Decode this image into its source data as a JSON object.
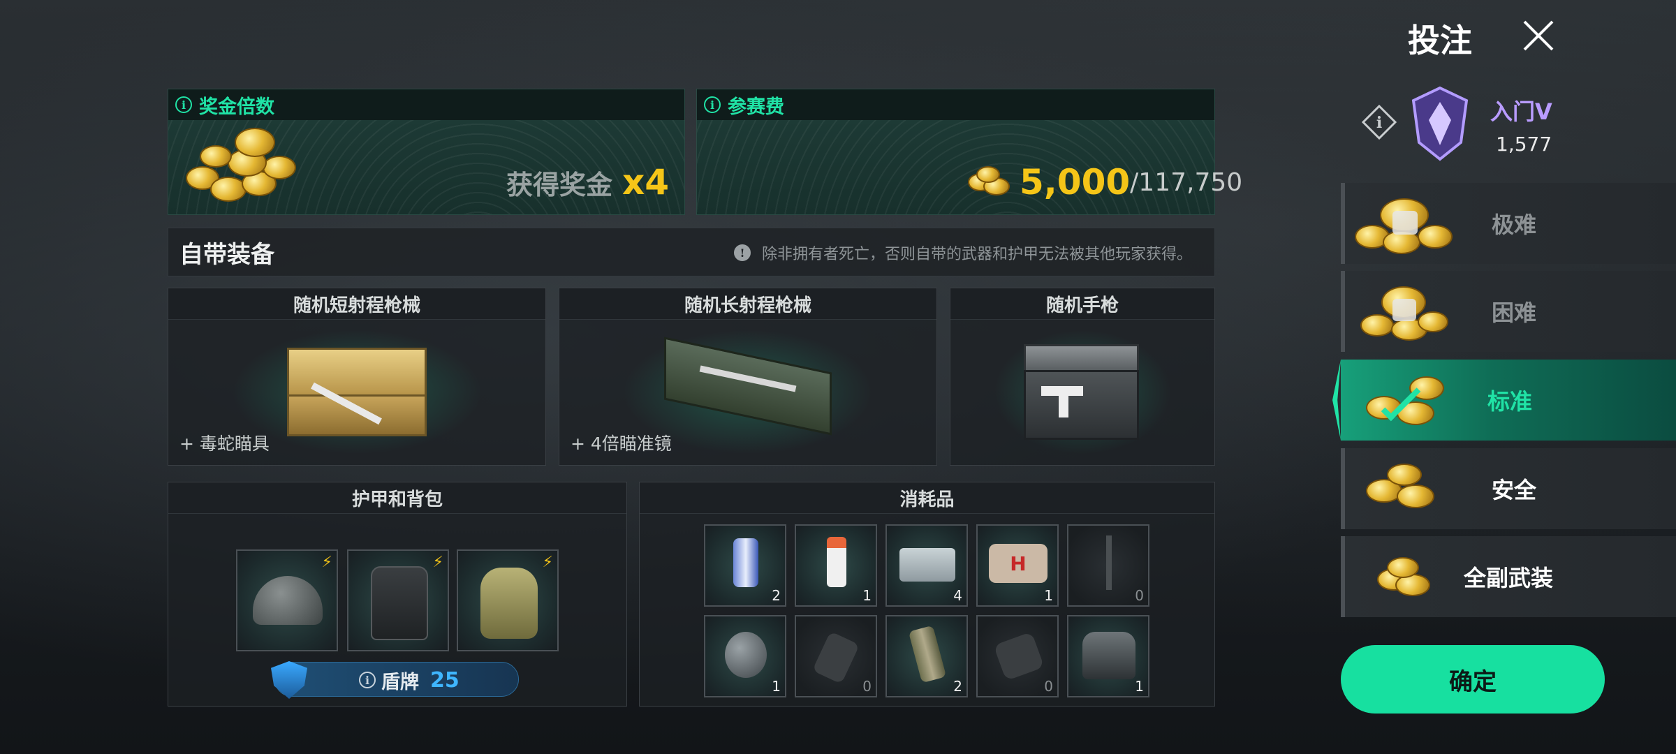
{
  "header": {
    "title": "投注"
  },
  "rank": {
    "name": "入门V",
    "points": "1,577"
  },
  "prize": {
    "header": "奖金倍数",
    "text": "获得奖金",
    "multiplier": "x4"
  },
  "fee": {
    "header": "参赛费",
    "amount": "5,000",
    "balance": "/117,750"
  },
  "equipment": {
    "title": "自带装备",
    "notice": "除非拥有者死亡，否则自带的武器和护甲无法被其他玩家获得。",
    "weapons": [
      {
        "title": "随机短射程枪械",
        "attachment": "+ 毒蛇瞄具"
      },
      {
        "title": "随机长射程枪械",
        "attachment": "+ 4倍瞄准镜"
      },
      {
        "title": "随机手枪",
        "attachment": ""
      }
    ]
  },
  "armor": {
    "title": "护甲和背包",
    "items": [
      {
        "icon": "helmet-icon"
      },
      {
        "icon": "vest-icon"
      },
      {
        "icon": "backpack-icon"
      }
    ],
    "shield_label": "盾牌",
    "shield_value": "25"
  },
  "consumables": {
    "title": "消耗品",
    "items": [
      {
        "icon": "energy-drink-icon",
        "count": "2"
      },
      {
        "icon": "painkiller-icon",
        "count": "1"
      },
      {
        "icon": "bandage-icon",
        "count": "4"
      },
      {
        "icon": "medkit-icon",
        "count": "1"
      },
      {
        "icon": "syringe-icon",
        "count": "0"
      },
      {
        "icon": "frag-grenade-icon",
        "count": "1"
      },
      {
        "icon": "molotov-icon",
        "count": "0"
      },
      {
        "icon": "smoke-grenade-icon",
        "count": "2"
      },
      {
        "icon": "stun-grenade-icon",
        "count": "0"
      },
      {
        "icon": "deployable-cover-icon",
        "count": "1"
      }
    ]
  },
  "difficulties": [
    {
      "name": "极难",
      "state": "locked"
    },
    {
      "name": "困难",
      "state": "locked"
    },
    {
      "name": "标准",
      "state": "selected"
    },
    {
      "name": "安全",
      "state": "available"
    },
    {
      "name": "全副武装",
      "state": "available"
    }
  ],
  "confirm_label": "确定",
  "colors": {
    "accent": "#20e3a6",
    "gold": "#f5c518",
    "rank": "#b99cff"
  }
}
